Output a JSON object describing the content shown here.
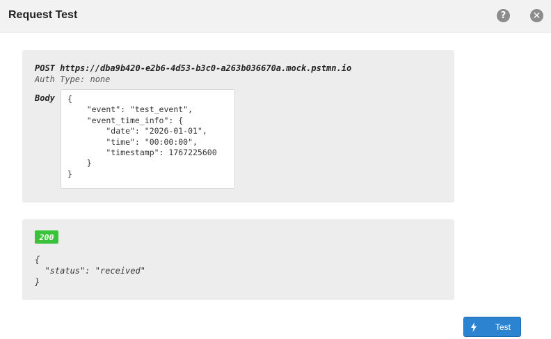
{
  "header": {
    "title": "Request Test",
    "help_icon": "question-circle-icon",
    "close_icon": "close-circle-icon",
    "help_glyph": "?",
    "close_glyph": "✕"
  },
  "request": {
    "method": "POST",
    "url": "https://dba9b420-e2b6-4d53-b3c0-a263b036670a.mock.pstmn.io",
    "auth_type": "Auth Type: none",
    "body_label": "Body",
    "body": "{\n    \"event\": \"test_event\",\n    \"event_time_info\": {\n        \"date\": \"2026-01-01\",\n        \"time\": \"00:00:00\",\n        \"timestamp\": 1767225600\n    }\n}"
  },
  "response": {
    "status_code": "200",
    "status_color": "#3ac23a",
    "body": "{\n  \"status\": \"received\"\n}"
  },
  "actions": {
    "test_label": "Test",
    "test_icon": "lightning-bolt-icon",
    "accent_color": "#2c83cf"
  }
}
